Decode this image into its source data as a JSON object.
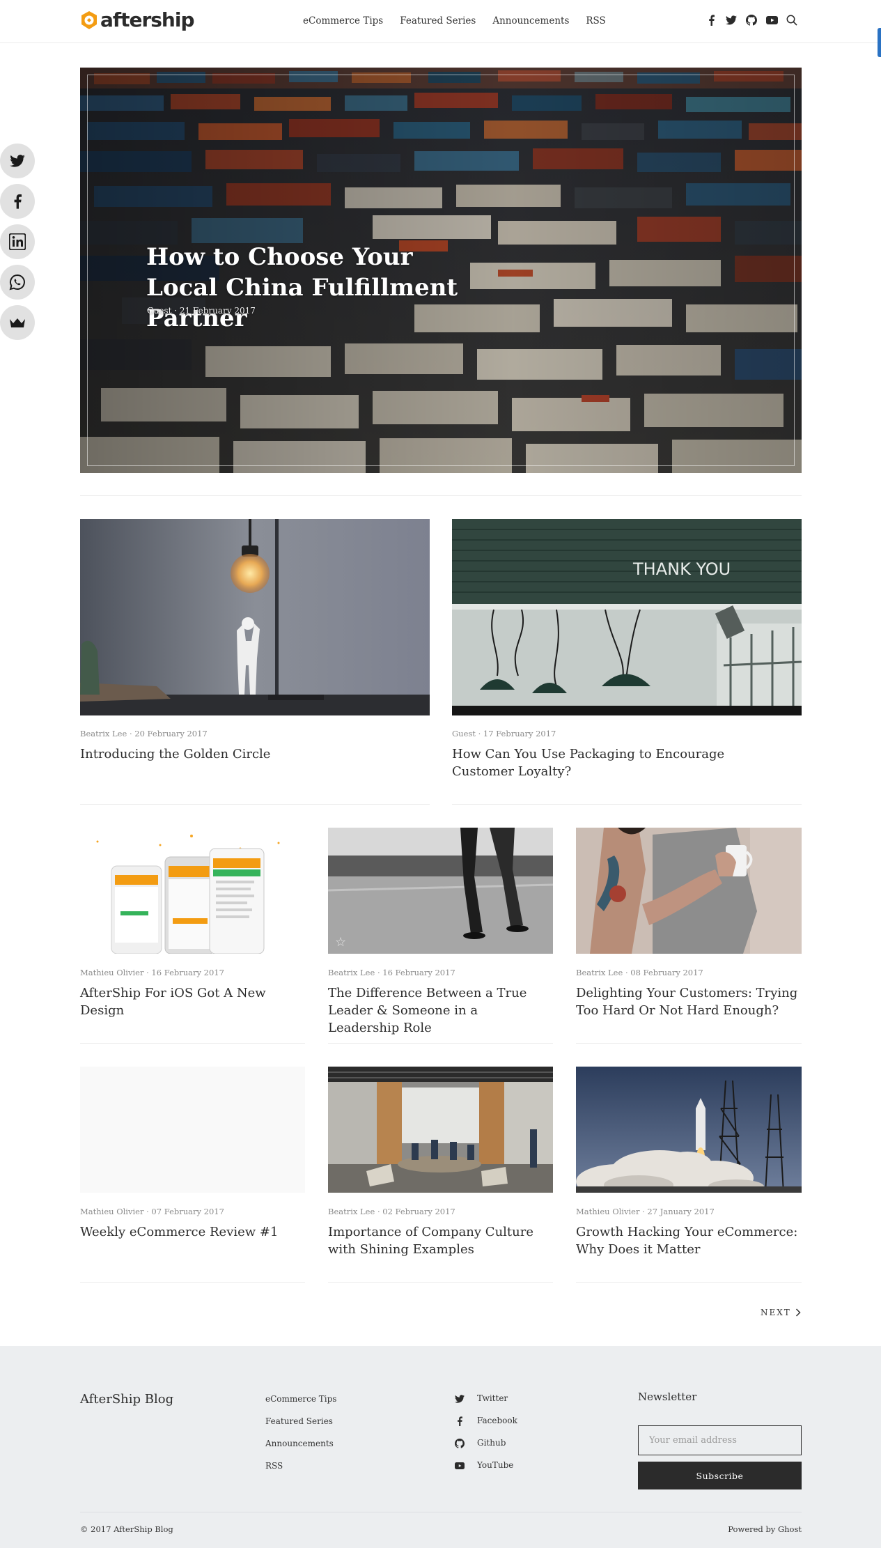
{
  "header": {
    "logo_text": "aftership",
    "nav": [
      "eCommerce Tips",
      "Featured Series",
      "Announcements",
      "RSS"
    ],
    "social_icons": [
      "facebook-icon",
      "twitter-icon",
      "github-icon",
      "youtube-icon",
      "search-icon"
    ]
  },
  "share_bar": [
    "twitter-icon",
    "facebook-icon",
    "linkedin-icon",
    "whatsapp-icon",
    "crown-icon"
  ],
  "hero": {
    "title": "How to Choose Your Local China Fulfillment Partner",
    "meta": "Guest · 21 February 2017"
  },
  "posts": [
    {
      "meta": "Beatrix Lee · 20 February 2017",
      "title": "Introducing the Golden Circle"
    },
    {
      "meta": "Guest · 17 February 2017",
      "title": "How Can You Use Packaging to Encourage Customer Loyalty?",
      "image_text": "THANK YOU"
    },
    {
      "meta": "Mathieu Olivier · 16 February 2017",
      "title": "AfterShip For iOS Got A New Design"
    },
    {
      "meta": "Beatrix Lee · 16 February 2017",
      "title": "The Difference Between a True Leader & Someone in a Leadership Role"
    },
    {
      "meta": "Beatrix Lee · 08 February 2017",
      "title": "Delighting Your Customers: Trying Too Hard Or Not Hard Enough?"
    },
    {
      "meta": "Mathieu Olivier · 07 February 2017",
      "title": "Weekly eCommerce Review #1"
    },
    {
      "meta": "Beatrix Lee · 02 February 2017",
      "title": "Importance of Company Culture with Shining Examples"
    },
    {
      "meta": "Mathieu Olivier · 27 January 2017",
      "title": "Growth Hacking Your eCommerce: Why Does it Matter"
    }
  ],
  "pagination": {
    "next": "NEXT"
  },
  "footer": {
    "blog_title": "AfterShip Blog",
    "links": [
      "eCommerce Tips",
      "Featured Series",
      "Announcements",
      "RSS"
    ],
    "social": [
      {
        "label": "Twitter",
        "icon": "twitter-icon"
      },
      {
        "label": "Facebook",
        "icon": "facebook-icon"
      },
      {
        "label": "Github",
        "icon": "github-icon"
      },
      {
        "label": "YouTube",
        "icon": "youtube-icon"
      }
    ],
    "newsletter_title": "Newsletter",
    "email_placeholder": "Your email address",
    "subscribe_label": "Subscribe",
    "copyright": "© 2017 AfterShip Blog",
    "powered_by": "Powered by Ghost"
  },
  "colors": {
    "brand_orange": "#f39c12",
    "dark": "#2b2b2b",
    "footer_bg": "#eceef0",
    "scroll_accent": "#2a72c3"
  }
}
